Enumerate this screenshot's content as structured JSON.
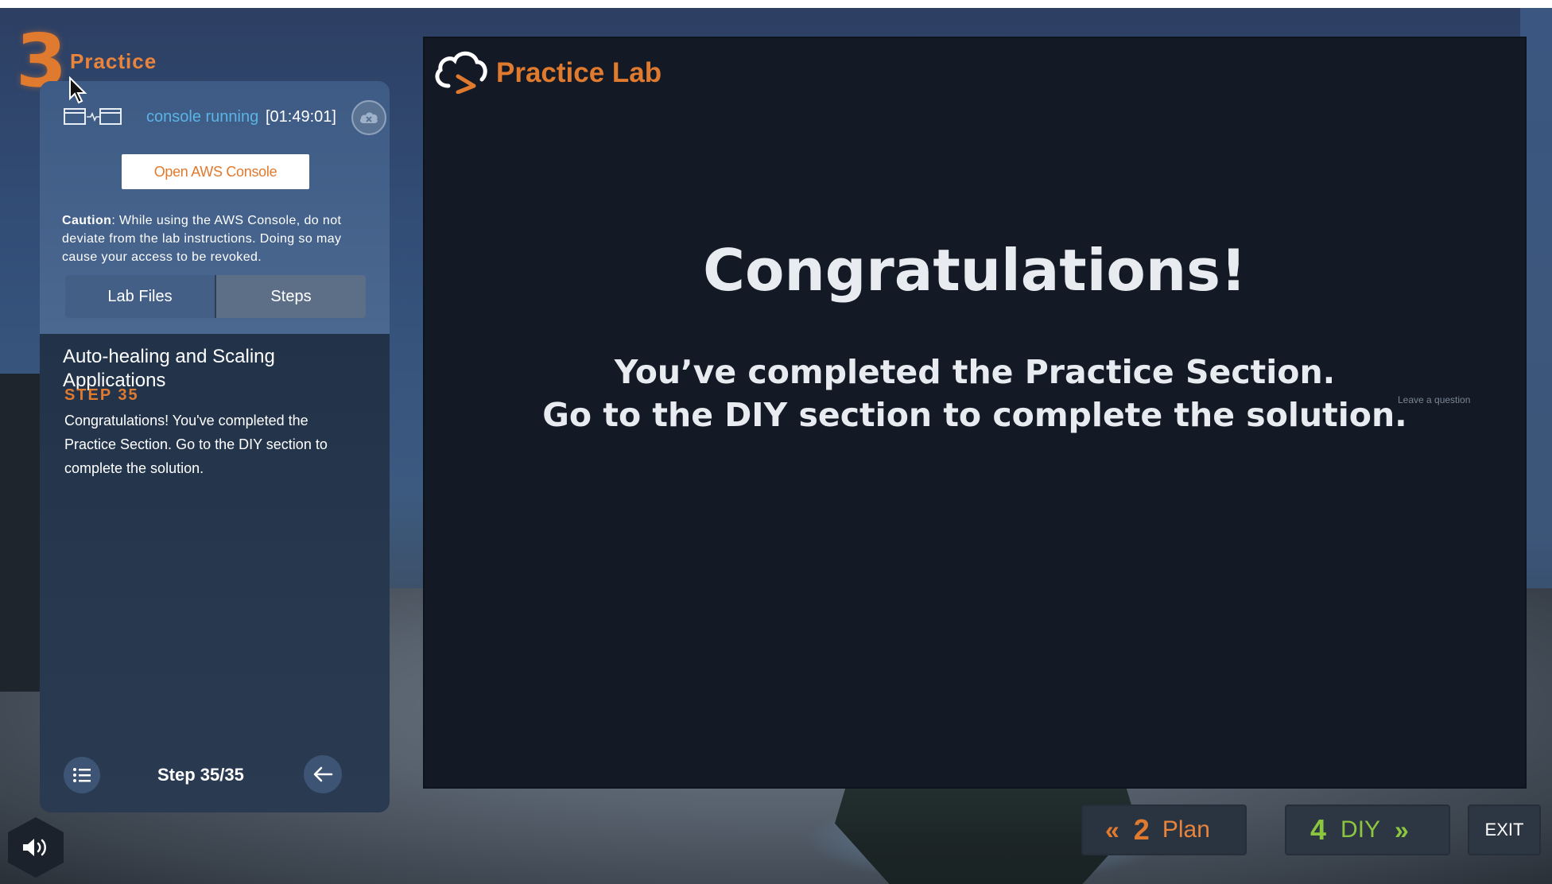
{
  "section": {
    "number": "3",
    "title": "Practice"
  },
  "console": {
    "status": "console running",
    "timer": "[01:49:01]",
    "open_button": "Open AWS Console",
    "caution_label": "Caution",
    "caution_text": ": While using the AWS Console, do not deviate from the lab instructions. Doing so may cause your access to be revoked."
  },
  "tabs": [
    {
      "label": "Lab Files",
      "selected": false
    },
    {
      "label": "Steps",
      "selected": true
    }
  ],
  "step": {
    "lab_title": "Auto-healing and Scaling Applications",
    "step_label": "STEP 35",
    "text": "Congratulations! You've completed the Practice Section. Go to the DIY section to complete the solution.",
    "counter": "Step 35/35"
  },
  "main": {
    "logo_text": "Practice Lab",
    "title": "Congratulations!",
    "line1": "You’ve completed the Practice Section.",
    "line2": "Go to the DIY section to complete the solution.",
    "overlay_text": "Leave a question"
  },
  "nav": {
    "plan": {
      "arrows": "«",
      "number": "2",
      "label": "Plan"
    },
    "diy": {
      "arrows": "»",
      "number": "4",
      "label": "DIY"
    },
    "exit": "EXIT"
  },
  "colors": {
    "accent_orange": "#e07a2e",
    "diy_green": "#8cc63f",
    "link_blue": "#5ab4e6"
  },
  "icons": [
    "cursor-icon",
    "console-link-icon",
    "cloud-icon",
    "list-icon",
    "back-arrow-icon",
    "cloud-logo-icon",
    "sound-icon"
  ]
}
